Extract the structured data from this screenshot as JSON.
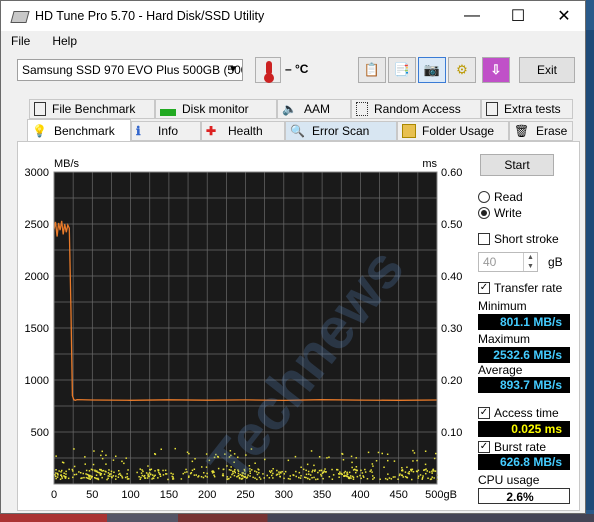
{
  "window": {
    "title": "HD Tune Pro 5.70 - Hard Disk/SSD Utility",
    "minimize": "—",
    "maximize": "☐",
    "close": "✕"
  },
  "menu": {
    "file": "File",
    "help": "Help"
  },
  "toolbar": {
    "drive": "Samsung SSD 970 EVO Plus 500GB (500",
    "temperature": "– °C",
    "exit_label": "Exit",
    "icons": [
      "copy-text-icon",
      "copy-info-icon",
      "camera-icon",
      "settings-icon",
      "save-icon"
    ]
  },
  "tabs_row1": [
    "File Benchmark",
    "Disk monitor",
    "AAM",
    "Random Access",
    "Extra tests"
  ],
  "tabs_row2": [
    "Benchmark",
    "Info",
    "Health",
    "Error Scan",
    "Folder Usage",
    "Erase"
  ],
  "side": {
    "start": "Start",
    "read": "Read",
    "write": "Write",
    "short_stroke": "Short stroke",
    "stroke_value": "40",
    "stroke_unit": "gB",
    "transfer_rate": "Transfer rate",
    "minimum_label": "Minimum",
    "minimum_value": "801.1 MB/s",
    "maximum_label": "Maximum",
    "maximum_value": "2532.6 MB/s",
    "average_label": "Average",
    "average_value": "893.7 MB/s",
    "access_time": "Access time",
    "access_value": "0.025 ms",
    "burst_rate": "Burst rate",
    "burst_value": "626.8 MB/s",
    "cpu_label": "CPU usage",
    "cpu_value": "2.6%"
  },
  "watermark": "Technews",
  "chart_data": {
    "type": "line",
    "ylabel_left": "MB/s",
    "ylabel_right": "ms",
    "x_ticks": [
      "0",
      "50",
      "100",
      "150",
      "200",
      "250",
      "300",
      "350",
      "400",
      "450",
      "500gB"
    ],
    "y_left_ticks": [
      "3000",
      "2500",
      "2000",
      "1500",
      "1000",
      "500"
    ],
    "y_right_ticks": [
      "0.60",
      "0.50",
      "0.40",
      "0.30",
      "0.20",
      "0.10"
    ],
    "xlim": [
      0,
      500
    ],
    "ylim_left": [
      0,
      3000
    ],
    "ylim_right": [
      0,
      0.6
    ],
    "grid": true,
    "colors": {
      "transfer": "#e87a2a",
      "access": "#e8e23a",
      "background": "#1a1a1a",
      "grid": "#6a6a6a"
    },
    "series": [
      {
        "role": "transfer_rate",
        "x": [
          0,
          2,
          4,
          6,
          8,
          10,
          12,
          14,
          16,
          18,
          20,
          22,
          24,
          26,
          28,
          30,
          50,
          100,
          150,
          200,
          250,
          300,
          350,
          400,
          450,
          500
        ],
        "y": [
          2450,
          2520,
          2380,
          2510,
          2440,
          2530,
          2400,
          2500,
          2420,
          2490,
          2460,
          1700,
          850,
          810,
          805,
          812,
          808,
          805,
          810,
          806,
          809,
          804,
          811,
          807,
          805,
          808
        ]
      },
      {
        "role": "access_time",
        "description": "scatter points clustered between 0.01 and 0.07 ms across 0-500 gB"
      }
    ]
  }
}
